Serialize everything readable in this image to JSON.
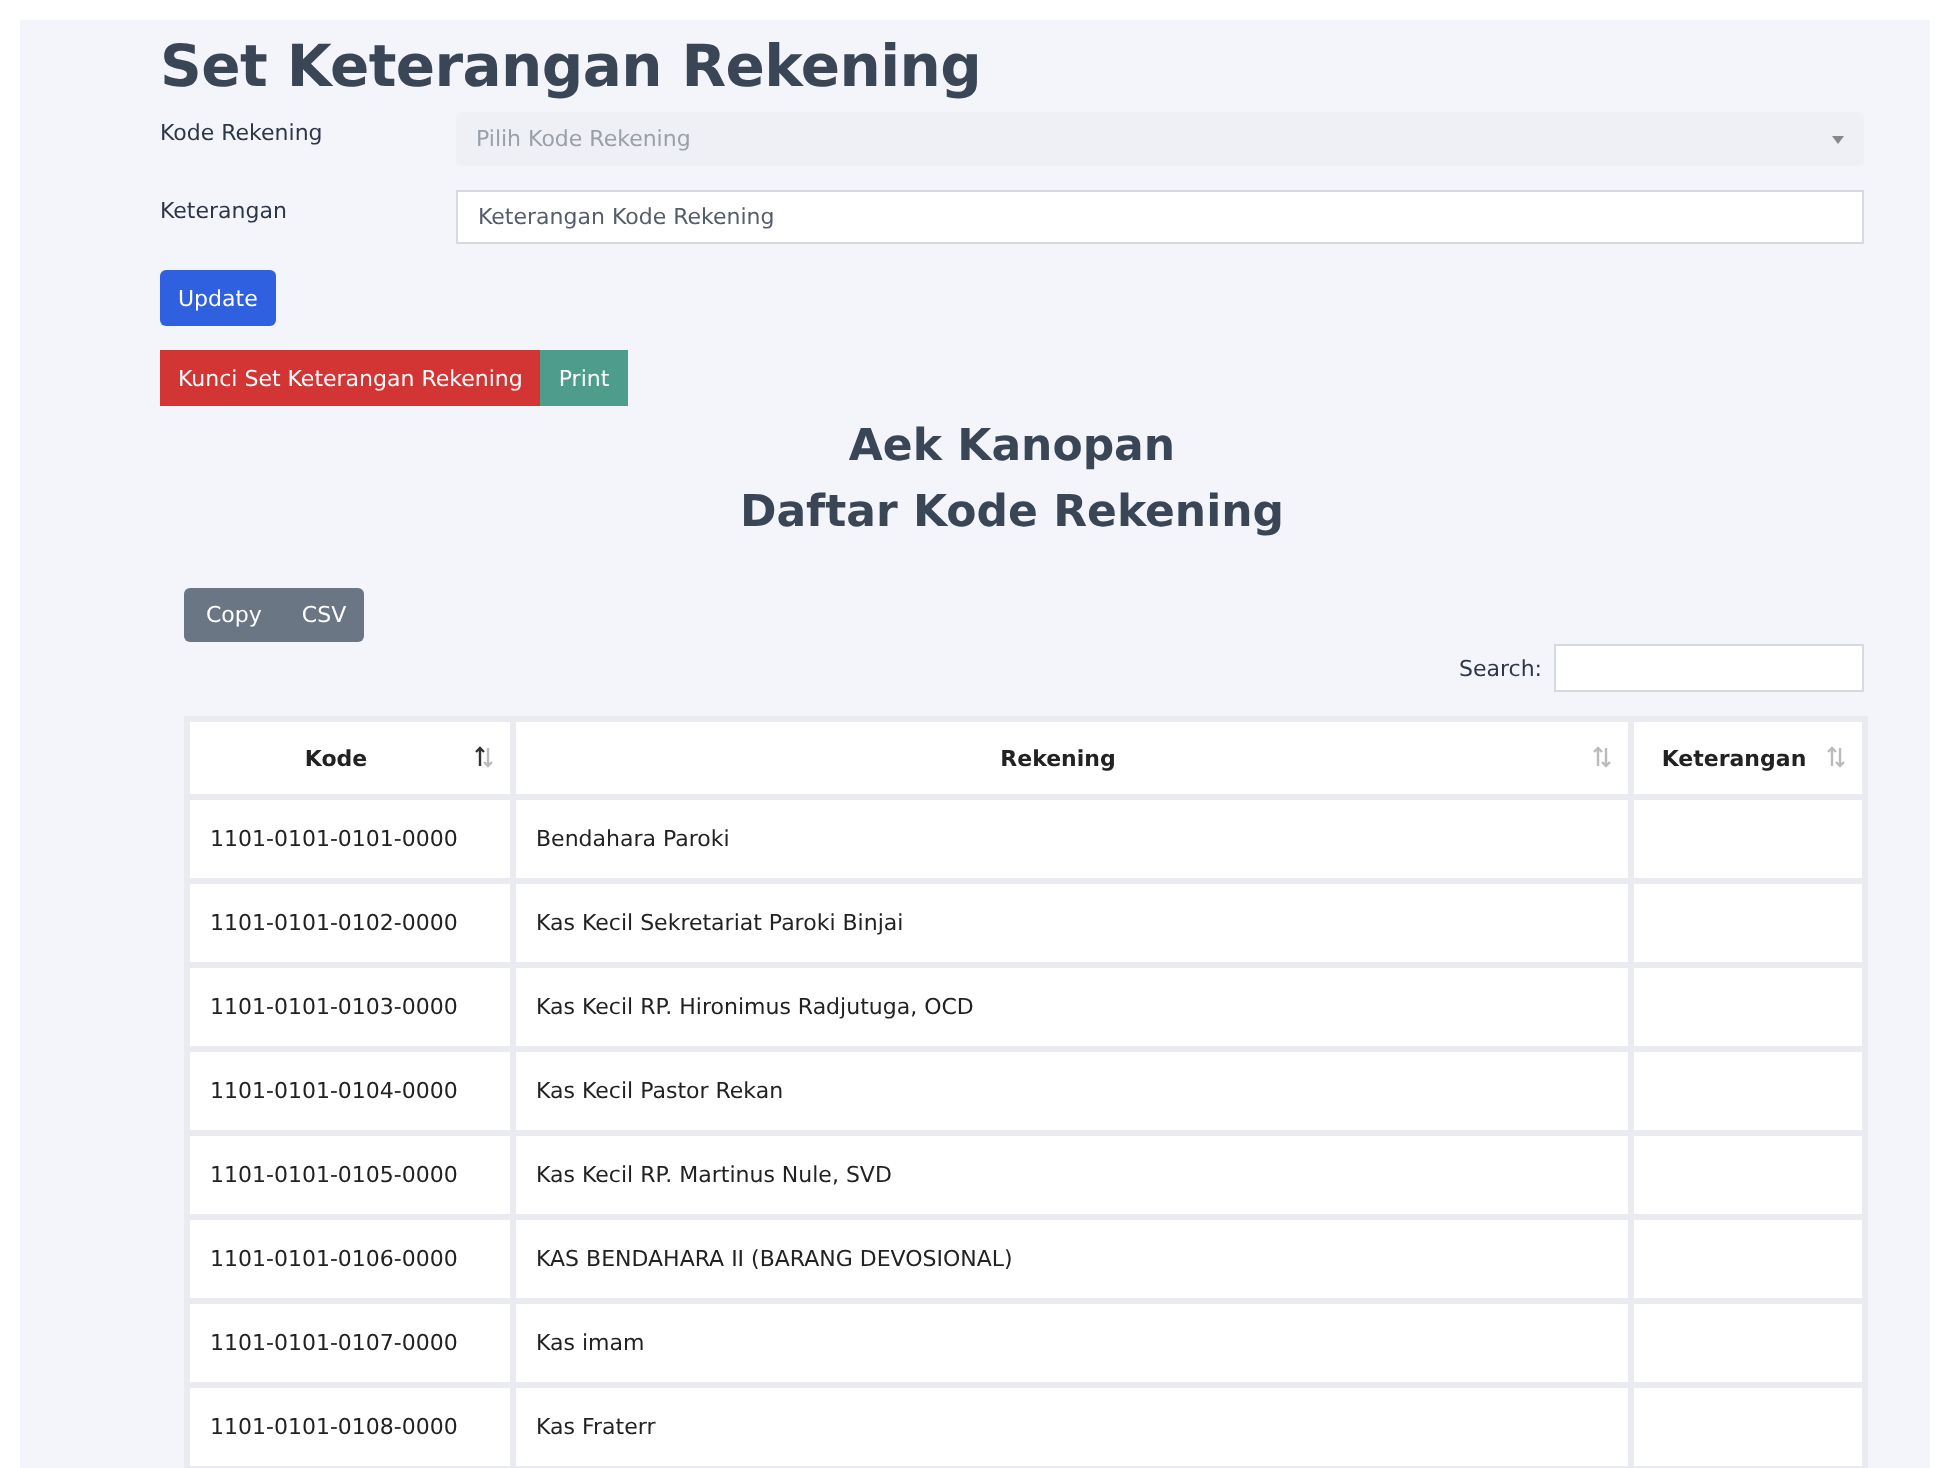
{
  "title": "Set Keterangan Rekening",
  "form": [
    {
      "kind": "select",
      "label": "Kode Rekening",
      "placeholder": "Pilih Kode Rekening"
    },
    {
      "kind": "input",
      "label": "Keterangan",
      "placeholder": "Keterangan Kode Rekening"
    }
  ],
  "update_button": "Update",
  "action_buttons": [
    {
      "label": "Kunci Set Keterangan Rekening",
      "color": "#d33434"
    },
    {
      "label": "Print",
      "color": "#4e9c8c"
    }
  ],
  "headings": [
    "Aek Kanopan",
    "Daftar Kode Rekening"
  ],
  "export_buttons": [
    "Copy",
    "CSV"
  ],
  "search": {
    "label": "Search:"
  },
  "table": {
    "columns": [
      {
        "label": "Kode",
        "sorted": true
      },
      {
        "label": "Rekening",
        "sorted": false
      },
      {
        "label": "Keterangan",
        "sorted": false
      }
    ],
    "rows": [
      [
        "1101-0101-0101-0000",
        "Bendahara Paroki"
      ],
      [
        "1101-0101-0102-0000",
        "Kas Kecil Sekretariat Paroki Binjai"
      ],
      [
        "1101-0101-0103-0000",
        "Kas Kecil RP. Hironimus Radjutuga, OCD"
      ],
      [
        "1101-0101-0104-0000",
        "Kas Kecil Pastor Rekan"
      ],
      [
        "1101-0101-0105-0000",
        "Kas Kecil RP. Martinus Nule, SVD"
      ],
      [
        "1101-0101-0106-0000",
        "KAS BENDAHARA II (BARANG DEVOSIONAL)"
      ],
      [
        "1101-0101-0107-0000",
        "Kas imam"
      ],
      [
        "1101-0101-0108-0000",
        "Kas Fraterr"
      ]
    ]
  }
}
